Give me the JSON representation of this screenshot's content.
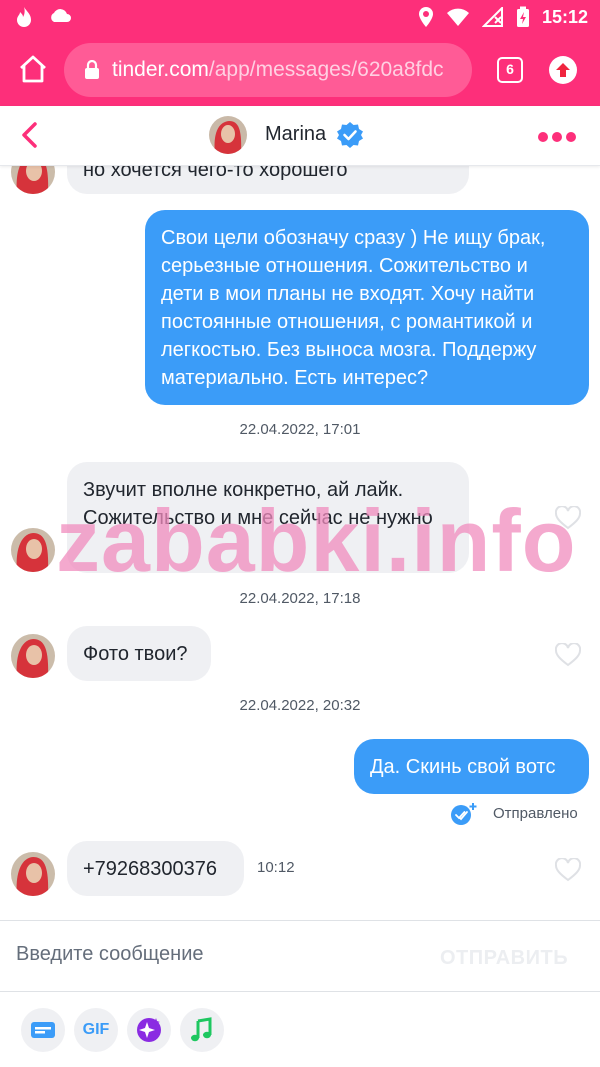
{
  "status_bar": {
    "time": "15:12"
  },
  "browser": {
    "url_host": "tinder.com",
    "url_path": "/app/messages/620a8fdc",
    "tab_count": "6"
  },
  "chat": {
    "name": "Marina"
  },
  "messages": {
    "m1_text": "но хочется чего-то хорошего",
    "m2_text": "Свои цели обозначу сразу ) Не ищу брак, серьезные отношения. Сожительство и дети в мои планы не входят. Хочу найти постоянные отношения, с романтикой и легкостью. Без выноса мозга. Поддержу материально. Есть интерес?",
    "stamp1": "22.04.2022, 17:01",
    "m3_text": "Звучит вполне конкретно, ай лайк. Сожительство и мне сейчас не нужно",
    "stamp2": "22.04.2022, 17:18",
    "m4_text": "Фото твои?",
    "stamp3": "22.04.2022, 20:32",
    "m5_text": "Да. Скинь свой вотс",
    "m5_status": "Отправлено",
    "m6_text": "+79268300376",
    "m6_time": "10:12"
  },
  "watermark": "zababki.info",
  "composer": {
    "placeholder": "Введите сообщение",
    "send_label": "ОТПРАВИТЬ"
  },
  "toolbar": {
    "gif_label": "GIF"
  },
  "colors": {
    "brand": "#fd2f7a",
    "outgoing": "#3b9cf8",
    "incoming": "#eff0f3"
  }
}
